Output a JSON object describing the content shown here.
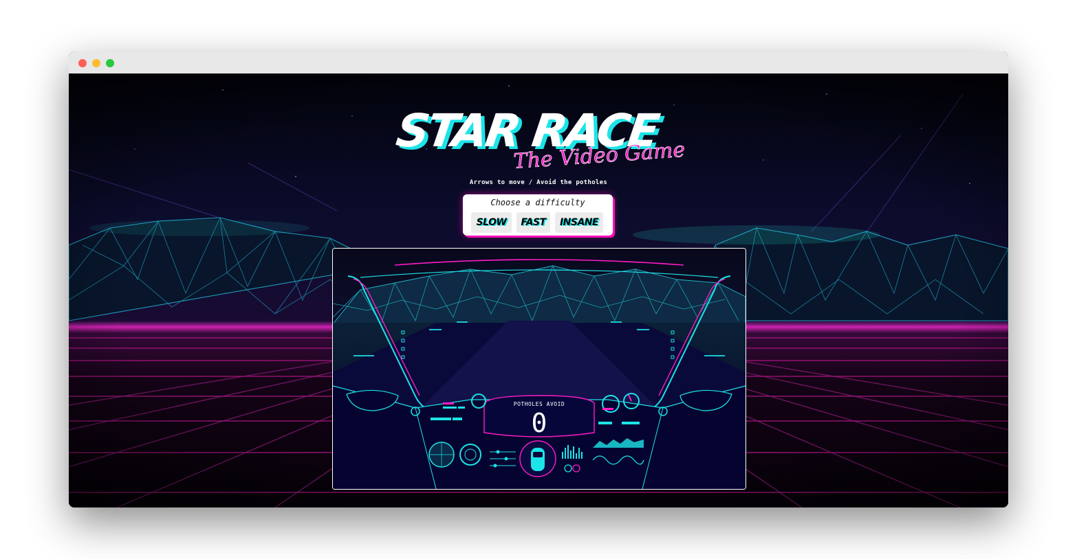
{
  "window": {
    "controls": [
      "close",
      "minimize",
      "maximize"
    ]
  },
  "game": {
    "title": "STAR RACE",
    "subtitle": "The Video Game",
    "instructions": "Arrows to move / Avoid the potholes",
    "difficulty": {
      "label": "Choose a difficulty",
      "options": [
        "SLOW",
        "FAST",
        "INSANE"
      ]
    },
    "hud": {
      "score_label": "POTHOLES AVOID",
      "score_value": "0"
    }
  },
  "colors": {
    "neon_pink": "#ff0fb8",
    "neon_cyan": "#1de4e8",
    "night_bg": "#050213",
    "grid_magenta": "#a8157f"
  }
}
